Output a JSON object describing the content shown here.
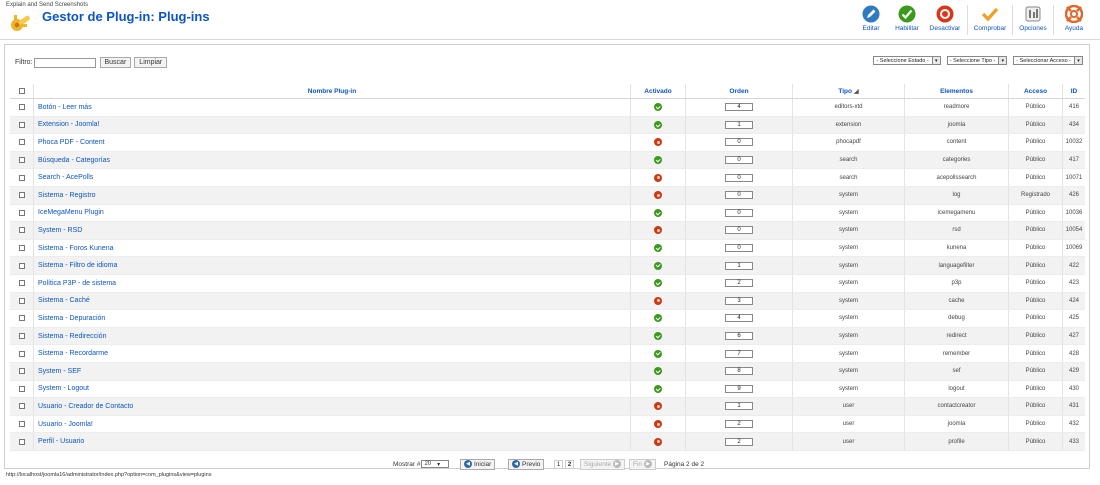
{
  "app": {
    "name": "Explain and Send Screenshots",
    "title": "Gestor de Plug-in: Plug-ins"
  },
  "toolbar": [
    {
      "label": "Editar",
      "icon": "edit-icon",
      "color": "#2f7bbf"
    },
    {
      "label": "Habilitar",
      "icon": "check-icon",
      "color": "#3a9a1c"
    },
    {
      "label": "Desactivar",
      "icon": "stop-icon",
      "color": "#d9361c"
    },
    {
      "label": "Comprobar",
      "icon": "checkmark-orange-icon",
      "color": "#f0a020"
    },
    {
      "label": "Opciones",
      "icon": "options-icon",
      "color": "#777777"
    },
    {
      "label": "Ayuda",
      "icon": "help-icon",
      "color": "#e0662a"
    }
  ],
  "filter": {
    "label": "Filtro:",
    "value": "",
    "search_label": "Buscar",
    "clear_label": "Limpiar",
    "select_state": "- Seleccione Estado -",
    "select_type": "- Seleccione Tipo -",
    "select_access": "- Seleccionar Acceso -"
  },
  "columns": {
    "name": "Nombre Plug-in",
    "enabled": "Activado",
    "order": "Orden",
    "type": "Tipo",
    "elements": "Elementos",
    "access": "Acceso",
    "id": "ID"
  },
  "rows": [
    {
      "name": "Botón - Leer más",
      "enabled": true,
      "order": "4",
      "type": "editors-xtd",
      "element": "readmore",
      "access": "Público",
      "id": "416"
    },
    {
      "name": "Extension - Joomla!",
      "enabled": true,
      "order": "1",
      "type": "extension",
      "element": "joomla",
      "access": "Público",
      "id": "434"
    },
    {
      "name": "Phoca PDF - Content",
      "enabled": false,
      "order": "0",
      "type": "phocapdf",
      "element": "content",
      "access": "Público",
      "id": "10032"
    },
    {
      "name": "Búsqueda - Categorías",
      "enabled": true,
      "order": "0",
      "type": "search",
      "element": "categories",
      "access": "Público",
      "id": "417"
    },
    {
      "name": "Search - AcePolls",
      "enabled": false,
      "order": "0",
      "type": "search",
      "element": "acepollssearch",
      "access": "Público",
      "id": "10071"
    },
    {
      "name": "Sistema - Registro",
      "enabled": false,
      "order": "0",
      "type": "system",
      "element": "log",
      "access": "Registrado",
      "id": "426"
    },
    {
      "name": "IceMegaMenu Plugin",
      "enabled": true,
      "order": "0",
      "type": "system",
      "element": "icemegamenu",
      "access": "Público",
      "id": "10036"
    },
    {
      "name": "System - RSD",
      "enabled": false,
      "order": "0",
      "type": "system",
      "element": "rsd",
      "access": "Público",
      "id": "10054"
    },
    {
      "name": "Sistema - Foros Kunena",
      "enabled": true,
      "order": "0",
      "type": "system",
      "element": "kunena",
      "access": "Público",
      "id": "10069"
    },
    {
      "name": "Sistema - Filtro de idioma",
      "enabled": true,
      "order": "1",
      "type": "system",
      "element": "languagefilter",
      "access": "Público",
      "id": "422"
    },
    {
      "name": "Política P3P - de sistema",
      "enabled": true,
      "order": "2",
      "type": "system",
      "element": "p3p",
      "access": "Público",
      "id": "423"
    },
    {
      "name": "Sistema - Caché",
      "enabled": false,
      "order": "3",
      "type": "system",
      "element": "cache",
      "access": "Público",
      "id": "424"
    },
    {
      "name": "Sistema - Depuración",
      "enabled": true,
      "order": "4",
      "type": "system",
      "element": "debug",
      "access": "Público",
      "id": "425"
    },
    {
      "name": "Sistema - Redirección",
      "enabled": true,
      "order": "6",
      "type": "system",
      "element": "redirect",
      "access": "Público",
      "id": "427"
    },
    {
      "name": "Sistema - Recordarme",
      "enabled": true,
      "order": "7",
      "type": "system",
      "element": "remember",
      "access": "Público",
      "id": "428"
    },
    {
      "name": "System - SEF",
      "enabled": true,
      "order": "8",
      "type": "system",
      "element": "sef",
      "access": "Público",
      "id": "429"
    },
    {
      "name": "System - Logout",
      "enabled": true,
      "order": "9",
      "type": "system",
      "element": "logout",
      "access": "Público",
      "id": "430"
    },
    {
      "name": "Usuario - Creador de Contacto",
      "enabled": false,
      "order": "1",
      "type": "user",
      "element": "contactcreator",
      "access": "Público",
      "id": "431"
    },
    {
      "name": "Usuario - Joomla!",
      "enabled": false,
      "order": "2",
      "type": "user",
      "element": "joomla",
      "access": "Público",
      "id": "432"
    },
    {
      "name": "Perfil - Usuario",
      "enabled": false,
      "order": "2",
      "type": "user",
      "element": "profile",
      "access": "Público",
      "id": "433"
    }
  ],
  "pagination": {
    "show_label": "Mostrar #",
    "show_value": "20",
    "start": "Iniciar",
    "prev": "Previo",
    "pages": [
      "1",
      "2"
    ],
    "next": "Siguiente",
    "end": "Fin",
    "page_info": "Página 2 de 2"
  },
  "status_url": "http://localhost/joomla16/administrator/index.php?option=com_plugins&view=plugins"
}
